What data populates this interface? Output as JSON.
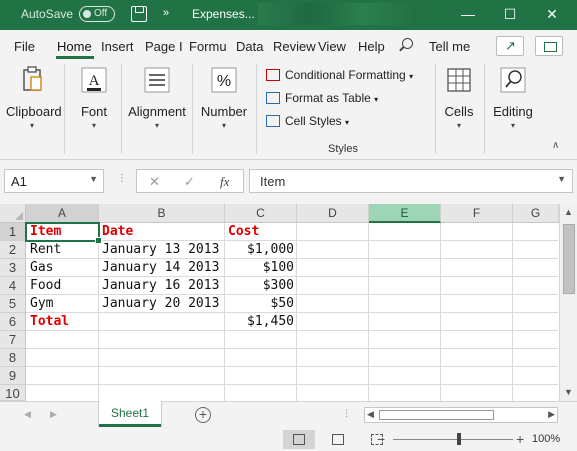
{
  "titlebar": {
    "autosave_label": "AutoSave",
    "autosave_state": "Off",
    "file_title": "Expenses...",
    "minimize": "—",
    "restore": "☐",
    "close": "✕"
  },
  "tabs": [
    "File",
    "Home",
    "Insert",
    "Page I",
    "Formu",
    "Data",
    "Review",
    "View",
    "Help"
  ],
  "active_tab": "Home",
  "tell_me": "Tell me",
  "ribbon": {
    "clipboard": "Clipboard",
    "font": "Font",
    "alignment": "Alignment",
    "number": "Number",
    "conditional_formatting": "Conditional Formatting",
    "format_as_table": "Format as Table",
    "cell_styles": "Cell Styles",
    "styles_group": "Styles",
    "cells": "Cells",
    "editing": "Editing"
  },
  "formula_bar": {
    "name_box": "A1",
    "fx": "fx",
    "content": "Item"
  },
  "columns": [
    "A",
    "B",
    "C",
    "D",
    "E",
    "F",
    "G"
  ],
  "rows": [
    "1",
    "2",
    "3",
    "4",
    "5",
    "6",
    "7",
    "8",
    "9",
    "10"
  ],
  "cells": {
    "A1": "Item",
    "B1": "Date",
    "C1": "Cost",
    "A2": "Rent",
    "B2": "January 13 2013",
    "C2": "$1,000",
    "A3": "Gas",
    "B3": "January 14 2013",
    "C3": "$100",
    "A4": "Food",
    "B4": "January 16 2013",
    "C4": "$300",
    "A5": "Gym",
    "B5": "January 20 2013",
    "C5": "$50",
    "A6": "Total",
    "C6": "$1,450"
  },
  "sheet_tab": "Sheet1",
  "status": {
    "zoom": "100%"
  },
  "colors": {
    "excel_green": "#217346",
    "header_text_red": "#e00000"
  }
}
